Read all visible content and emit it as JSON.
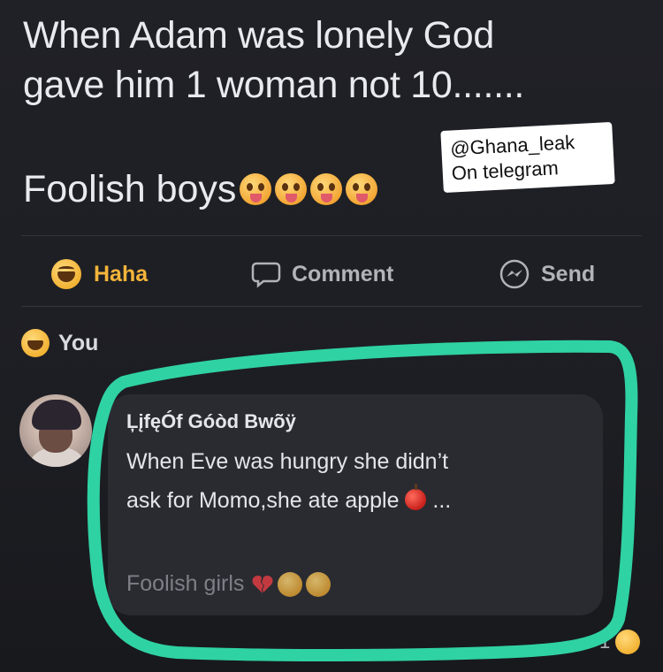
{
  "post": {
    "line1": "When Adam was lonely God",
    "line2": "gave him 1 woman not 10.......",
    "line3": "Foolish boys"
  },
  "watermark": {
    "line1": "@Ghana_leak",
    "line2": "On telegram"
  },
  "actions": {
    "haha": "Haha",
    "comment": "Comment",
    "send": "Send"
  },
  "reactions": {
    "you_label": "You"
  },
  "comment": {
    "author": "ĻįfęÓf Góòd Bwõÿ",
    "line1": "When Eve was hungry she didn’t",
    "line2": "ask for Momo,she ate apple",
    "ellipsis": "...",
    "line3": "Foolish girls",
    "reaction_count": "1"
  },
  "colors": {
    "background": "#1c1d22",
    "highlight": "#2fd2a3",
    "haha_accent": "#f4b43a",
    "bubble": "#2a2b31"
  }
}
